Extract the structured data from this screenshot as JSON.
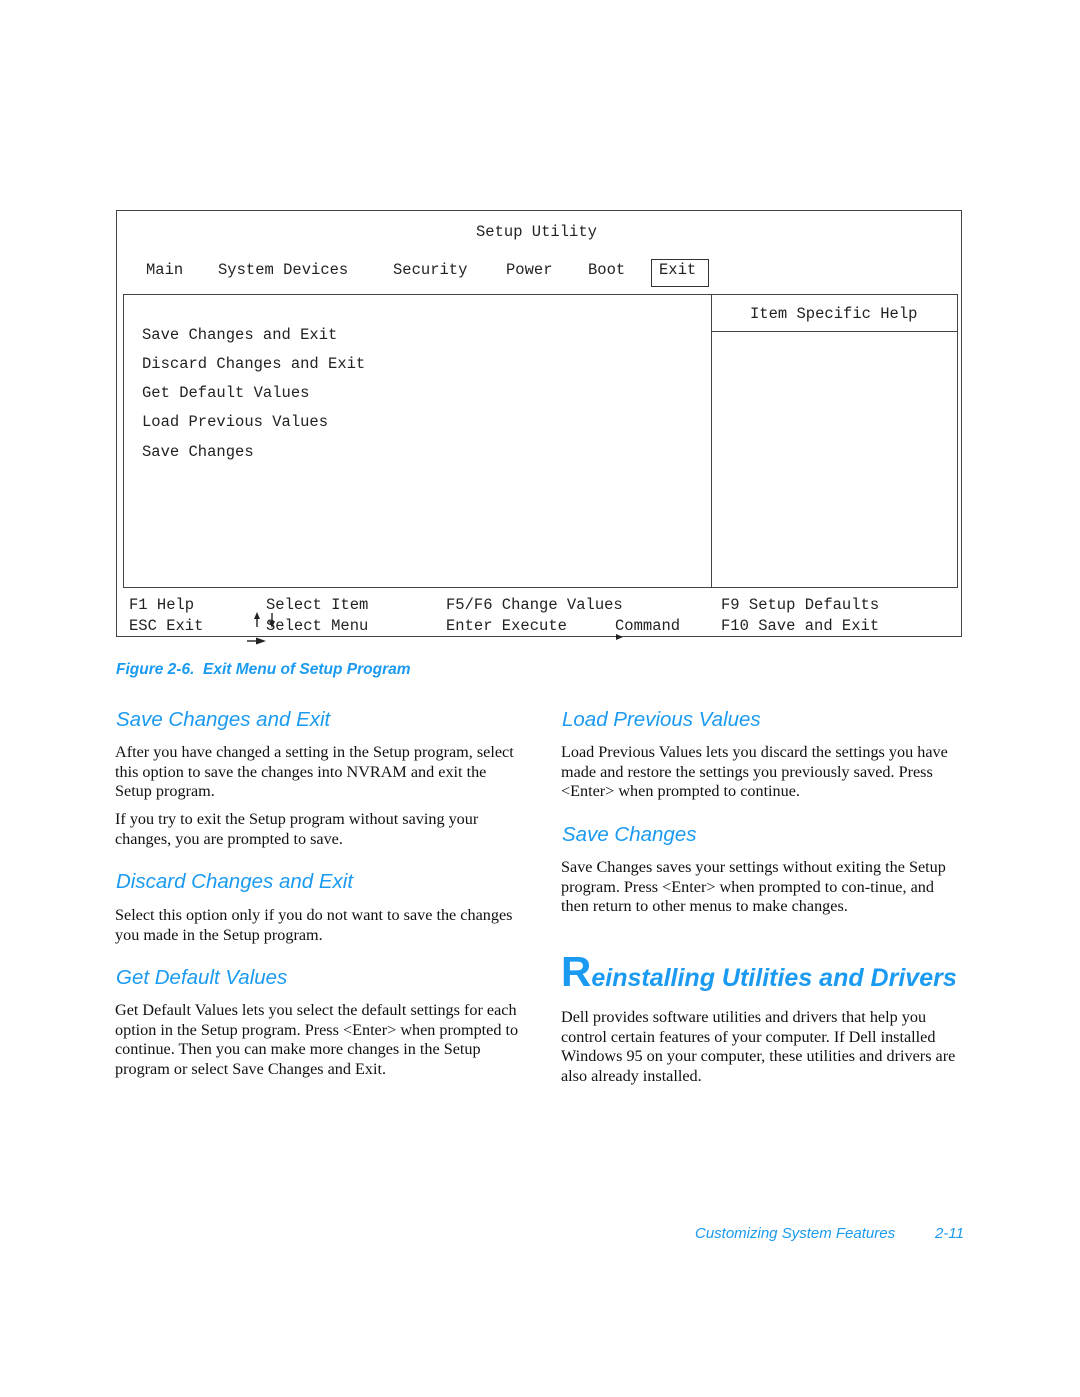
{
  "figure": {
    "title": "Setup Utility",
    "menu": [
      {
        "label": "Main",
        "selected": false
      },
      {
        "label": "System Devices",
        "selected": false
      },
      {
        "label": "Security",
        "selected": false
      },
      {
        "label": "Power",
        "selected": false
      },
      {
        "label": "Boot",
        "selected": false
      },
      {
        "label": "Exit",
        "selected": true
      }
    ],
    "options": [
      "Save Changes and Exit",
      "Discard Changes and Exit",
      "Get Default Values",
      "Load Previous Values",
      "Save Changes"
    ],
    "help_title": "Item Specific Help",
    "keys": {
      "row1": {
        "f1": "F1 Help",
        "select_item": "Select Item",
        "change_values": "F5/F6 Change Values",
        "setup_defaults": "F9 Setup Defaults"
      },
      "row2": {
        "esc": "ESC Exit",
        "select_menu": "Select Menu",
        "execute": "Enter Execute",
        "command": "Command",
        "save_exit": "F10 Save and Exit"
      },
      "icons": {
        "up_down": "up-down-arrows-icon",
        "right": "right-arrow-icon",
        "submenu": "submenu-pointer-icon"
      }
    }
  },
  "caption": "Figure 2-6.  Exit Menu of Setup Program",
  "sections_left": [
    {
      "heading": "Save Changes and Exit",
      "paragraphs": [
        "After you have changed a setting in the Setup program, select this option to save the changes into NVRAM and exit the Setup program.",
        "If you try to exit the Setup program without saving your changes, you are prompted to save."
      ]
    },
    {
      "heading": "Discard Changes and Exit",
      "paragraphs": [
        "Select this option only if you do not want to save the changes you made in the Setup program."
      ]
    },
    {
      "heading": "Get Default Values",
      "paragraphs": [
        "Get Default Values lets you select the default settings for each option in the Setup program. Press <Enter> when prompted to continue. Then you can make more changes in the Setup program or select Save Changes and Exit."
      ]
    }
  ],
  "sections_right": [
    {
      "heading": "Load Previous Values",
      "paragraphs": [
        "Load Previous Values lets you discard the settings you have made and restore the settings you previously saved. Press <Enter> when prompted to continue."
      ]
    },
    {
      "heading": "Save Changes",
      "paragraphs": [
        "Save Changes saves your settings without exiting the Setup program. Press <Enter> when prompted to con-tinue, and then return to other menus to make changes."
      ]
    }
  ],
  "chapter": {
    "title_initial": "R",
    "title_rest": "einstalling Utilities and Drivers",
    "paragraph": "Dell provides software utilities and drivers that help you control certain features of your computer. If Dell installed Windows 95 on your computer, these utilities and drivers are also already installed."
  },
  "footer": {
    "section": "Customizing System Features",
    "page": "2-11"
  },
  "colors": {
    "accent_blue": "#1a9af0",
    "border": "#444444"
  }
}
